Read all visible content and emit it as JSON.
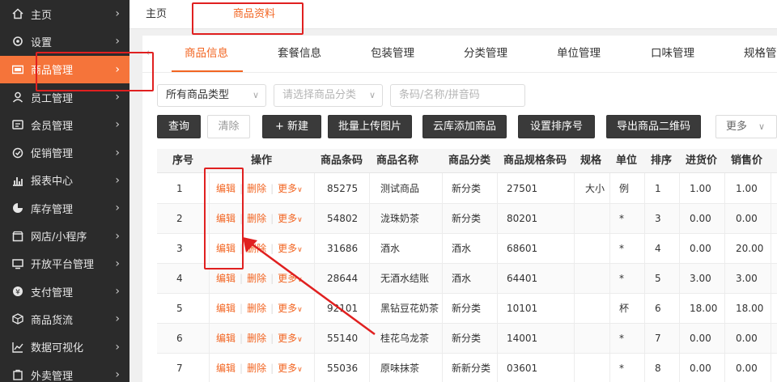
{
  "sidebar": {
    "items": [
      {
        "label": "主页",
        "icon": "home-icon",
        "active": false
      },
      {
        "label": "设置",
        "icon": "gear-icon",
        "active": false
      },
      {
        "label": "商品管理",
        "icon": "goods-icon",
        "active": true
      },
      {
        "label": "员工管理",
        "icon": "staff-icon",
        "active": false
      },
      {
        "label": "会员管理",
        "icon": "member-icon",
        "active": false
      },
      {
        "label": "促销管理",
        "icon": "promotion-icon",
        "active": false
      },
      {
        "label": "报表中心",
        "icon": "report-icon",
        "active": false
      },
      {
        "label": "库存管理",
        "icon": "inventory-icon",
        "active": false
      },
      {
        "label": "网店/小程序",
        "icon": "shop-icon",
        "active": false
      },
      {
        "label": "开放平台管理",
        "icon": "platform-icon",
        "active": false
      },
      {
        "label": "支付管理",
        "icon": "payment-icon",
        "active": false
      },
      {
        "label": "商品货流",
        "icon": "goods-flow-icon",
        "active": false
      },
      {
        "label": "数据可视化",
        "icon": "chart-icon",
        "active": false
      },
      {
        "label": "外卖管理",
        "icon": "takeout-icon",
        "active": false
      }
    ]
  },
  "topbar": {
    "home": "主页",
    "active": "商品资料"
  },
  "subtabs": [
    "商品信息",
    "套餐信息",
    "包装管理",
    "分类管理",
    "单位管理",
    "口味管理",
    "规格管"
  ],
  "filters": {
    "type": "所有商品类型",
    "category_placeholder": "请选择商品分类",
    "search_placeholder": "条码/名称/拼音码"
  },
  "buttons": {
    "query": "查询",
    "clear": "清除",
    "new": "+ 新建",
    "upload": "批量上传图片",
    "cloud": "云库添加商品",
    "sort": "设置排序号",
    "export_qr": "导出商品二维码",
    "more": "更多"
  },
  "table": {
    "headers": [
      "序号",
      "操作",
      "商品条码",
      "商品名称",
      "商品分类",
      "商品规格条码",
      "规格",
      "单位",
      "排序",
      "进货价",
      "销售价"
    ],
    "op_edit": "编辑",
    "op_delete": "删除",
    "op_more": "更多",
    "rows": [
      [
        "1",
        "85275",
        "测试商品",
        "新分类",
        "27501",
        "大小",
        "例",
        "1",
        "1.00",
        "1.00"
      ],
      [
        "2",
        "54802",
        "泷珠奶茶",
        "新分类",
        "80201",
        "",
        "*",
        "3",
        "0.00",
        "0.00"
      ],
      [
        "3",
        "31686",
        "酒水",
        "酒水",
        "68601",
        "",
        "*",
        "4",
        "0.00",
        "20.00"
      ],
      [
        "4",
        "28644",
        "无酒水结账",
        "酒水",
        "64401",
        "",
        "*",
        "5",
        "3.00",
        "3.00"
      ],
      [
        "5",
        "92101",
        "黑钻豆花奶茶",
        "新分类",
        "10101",
        "",
        "杯",
        "6",
        "18.00",
        "18.00"
      ],
      [
        "6",
        "55140",
        "桂花乌龙茶",
        "新分类",
        "14001",
        "",
        "*",
        "7",
        "0.00",
        "0.00"
      ],
      [
        "7",
        "55036",
        "原味抹茶",
        "新新分类",
        "03601",
        "",
        "*",
        "8",
        "0.00",
        "0.00"
      ]
    ]
  },
  "colors": {
    "accent": "#f26522",
    "sidebar_bg": "#2b2b2b",
    "active_bg": "#f5743a",
    "annotation": "#e02020"
  }
}
